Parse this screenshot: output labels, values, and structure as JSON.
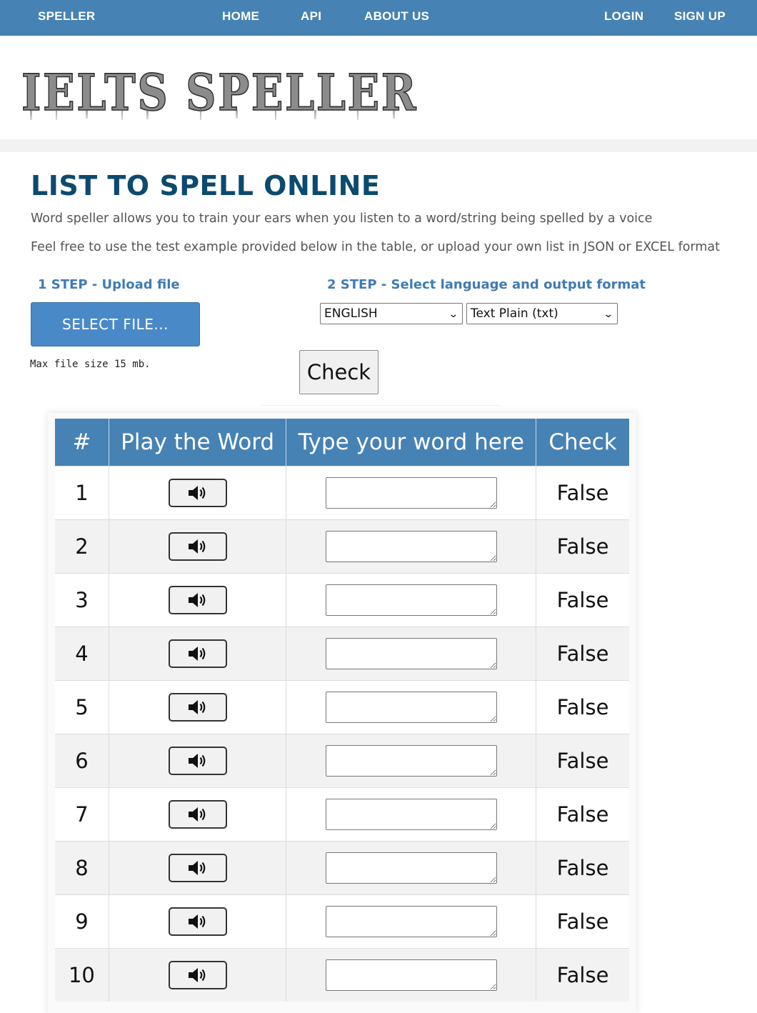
{
  "nav": {
    "brand": "SPELLER",
    "home": "HOME",
    "api": "API",
    "about": "ABOUT US",
    "login": "LOGIN",
    "signup": "SIGN UP"
  },
  "logo": {
    "text": "IELTS SPELLER"
  },
  "page": {
    "title": "LIST TO SPELL ONLINE",
    "desc1": "Word speller allows you to train your ears when you listen to a word/string being spelled by a voice",
    "desc2": "Feel free to use the test example provided below in the table, or upload your own list in JSON or EXCEL format"
  },
  "upload": {
    "step1": "1 STEP - Upload file",
    "select_file": "SELECT FILE...",
    "max_size": "Max file size 15 mb."
  },
  "options": {
    "step2": "2 STEP - Select language and output format",
    "language": "ENGLISH",
    "format": "Text Plain (txt)"
  },
  "check_button": "Check",
  "table": {
    "headers": [
      "#",
      "Play the Word",
      "Type your word here",
      "Check"
    ],
    "rows": [
      {
        "num": "1",
        "result": "False"
      },
      {
        "num": "2",
        "result": "False"
      },
      {
        "num": "3",
        "result": "False"
      },
      {
        "num": "4",
        "result": "False"
      },
      {
        "num": "5",
        "result": "False"
      },
      {
        "num": "6",
        "result": "False"
      },
      {
        "num": "7",
        "result": "False"
      },
      {
        "num": "8",
        "result": "False"
      },
      {
        "num": "9",
        "result": "False"
      },
      {
        "num": "10",
        "result": "False"
      }
    ]
  },
  "icons": {
    "play": "speaker-volume-icon",
    "dropdown": "chevron-down-icon"
  },
  "colors": {
    "nav": "#4682b4",
    "title": "#0c4a6e",
    "step": "#3f7bb3",
    "button": "#4a89c8",
    "table_header": "#4682b4"
  }
}
